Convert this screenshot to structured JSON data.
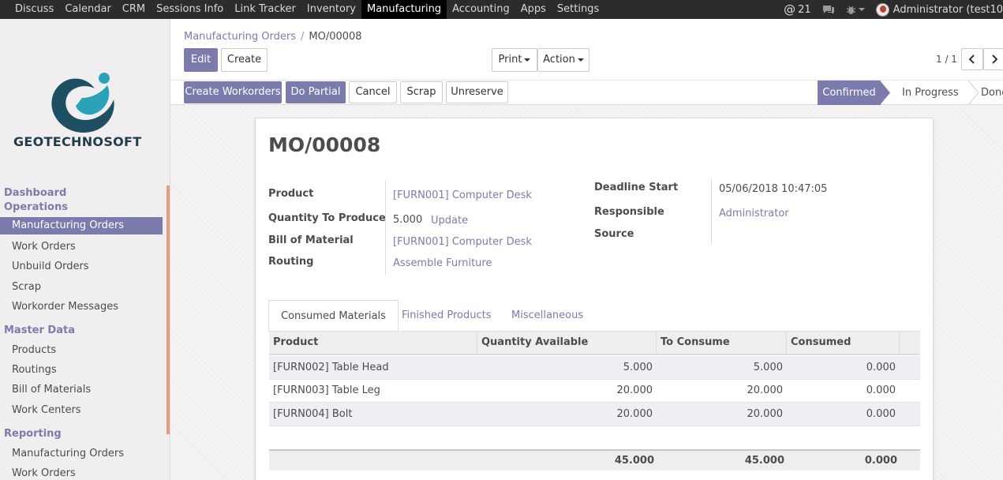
{
  "topbar": {
    "menu": [
      "Discuss",
      "Calendar",
      "CRM",
      "Sessions Info",
      "Link Tracker",
      "Inventory",
      "Manufacturing",
      "Accounting",
      "Apps",
      "Settings"
    ],
    "active_menu": "Manufacturing",
    "notification_count": "21",
    "user_name": "Administrator (test10"
  },
  "sidebar": {
    "logo_text": "GEOTECHNOSOFT",
    "sections": [
      {
        "title": "Dashboard Operations",
        "items": [
          "Manufacturing Orders",
          "Work Orders",
          "Unbuild Orders",
          "Scrap",
          "Workorder Messages"
        ]
      },
      {
        "title": "Master Data",
        "items": [
          "Products",
          "Routings",
          "Bill of Materials",
          "Work Centers"
        ]
      },
      {
        "title": "Reporting",
        "items": [
          "Manufacturing Orders",
          "Work Orders"
        ]
      }
    ],
    "active_item": "Manufacturing Orders",
    "brand_colors": {
      "logo_dark": "#1f4f63",
      "logo_light": "#2aa3b8"
    }
  },
  "breadcrumb": {
    "parent": "Manufacturing Orders",
    "sep": "/",
    "current": "MO/00008"
  },
  "buttons": {
    "edit": "Edit",
    "create": "Create",
    "print": "Print",
    "action": "Action",
    "create_workorders": "Create Workorders",
    "do_partial": "Do Partial",
    "cancel": "Cancel",
    "scrap": "Scrap",
    "unreserve": "Unreserve"
  },
  "pager": {
    "text": "1 / 1"
  },
  "statusbar": {
    "stages": [
      "Confirmed",
      "In Progress",
      "Done"
    ],
    "current": "Confirmed"
  },
  "record": {
    "name": "MO/00008",
    "fields_left": {
      "product_label": "Product",
      "product_value": "[FURN001] Computer Desk",
      "qty_label": "Quantity To Produce",
      "qty_value": "5.000",
      "qty_update": "Update",
      "bom_label": "Bill of Material",
      "bom_value": "[FURN001] Computer Desk",
      "routing_label": "Routing",
      "routing_value": "Assemble Furniture"
    },
    "fields_right": {
      "deadline_label": "Deadline Start",
      "deadline_value": "05/06/2018 10:47:05",
      "responsible_label": "Responsible",
      "responsible_value": "Administrator",
      "source_label": "Source",
      "source_value": ""
    }
  },
  "tabs": [
    "Consumed Materials",
    "Finished Products",
    "Miscellaneous"
  ],
  "active_tab": "Consumed Materials",
  "table": {
    "columns": [
      "Product",
      "Quantity Available",
      "To Consume",
      "Consumed"
    ],
    "rows": [
      [
        "[FURN002] Table Head",
        "5.000",
        "5.000",
        "0.000"
      ],
      [
        "[FURN003] Table Leg",
        "20.000",
        "20.000",
        "0.000"
      ],
      [
        "[FURN004] Bolt",
        "20.000",
        "20.000",
        "0.000"
      ]
    ],
    "totals": [
      "45.000",
      "45.000",
      "0.000"
    ]
  },
  "colors": {
    "accent": "#7c7bad",
    "topbar": "#2c2c2c"
  }
}
